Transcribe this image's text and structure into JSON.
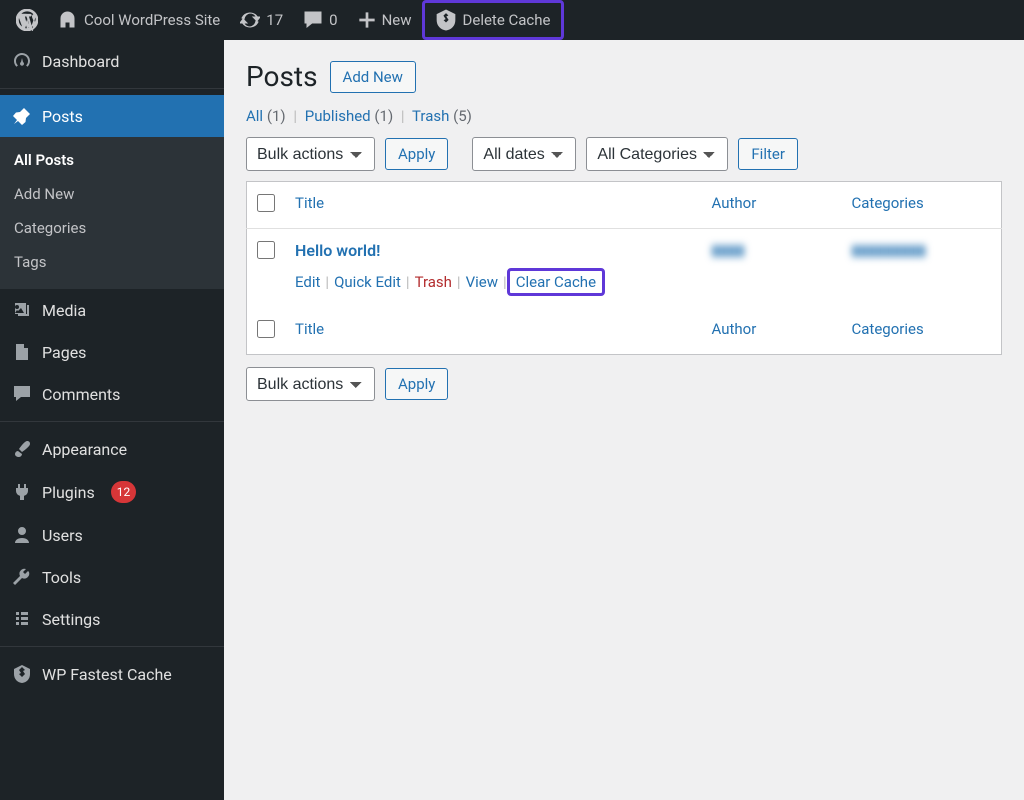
{
  "toolbar": {
    "site_name": "Cool WordPress Site",
    "updates_count": "17",
    "comments_count": "0",
    "new_label": "New",
    "delete_cache": "Delete Cache"
  },
  "sidebar": {
    "dashboard": "Dashboard",
    "posts": "Posts",
    "posts_sub": {
      "all": "All Posts",
      "add": "Add New",
      "cats": "Categories",
      "tags": "Tags"
    },
    "media": "Media",
    "pages": "Pages",
    "comments": "Comments",
    "appearance": "Appearance",
    "plugins": "Plugins",
    "plugins_badge": "12",
    "users": "Users",
    "tools": "Tools",
    "settings": "Settings",
    "wpfc": "WP Fastest Cache"
  },
  "page": {
    "title": "Posts",
    "add_new": "Add New",
    "filters": {
      "all": "All",
      "all_c": "(1)",
      "published": "Published",
      "published_c": "(1)",
      "trash": "Trash",
      "trash_c": "(5)"
    },
    "bulk": "Bulk actions",
    "apply": "Apply",
    "all_dates": "All dates",
    "all_cats": "All Categories",
    "filter": "Filter",
    "cols": {
      "title": "Title",
      "author": "Author",
      "cats": "Categories"
    },
    "row": {
      "title": "Hello world!",
      "edit": "Edit",
      "quick": "Quick Edit",
      "trash": "Trash",
      "view": "View",
      "clear": "Clear Cache",
      "author_blur": "▮▮▮▮",
      "cat_blur": "▮▮▮▮▮▮▮▮▮"
    }
  }
}
